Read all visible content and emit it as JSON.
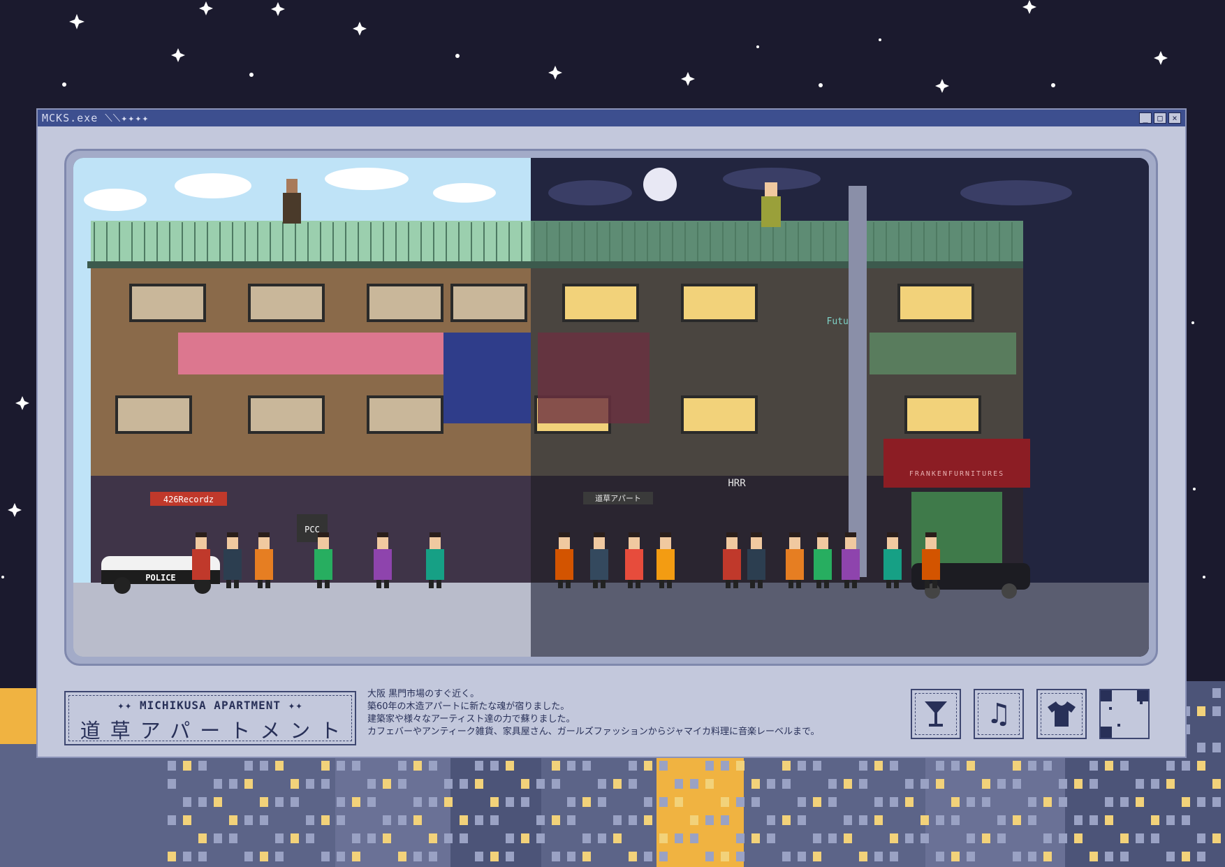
{
  "window": {
    "title": "MCKS.exe ⟍⟍✦✦✦✦",
    "min_label": "_",
    "max_label": "□",
    "close_label": "×"
  },
  "scene": {
    "signs": {
      "records": "426Recordz",
      "police": "POLICE",
      "pcc": "PCC",
      "apartment_sign": "道草アパート",
      "hrr": "HRR",
      "future": "Future",
      "furniture": "FRANKENFURNITURES"
    }
  },
  "label": {
    "english": "✦✦ MICHIKUSA APARTMENT ✦✦",
    "japanese": "道草アパートメント"
  },
  "description": {
    "lines": [
      "大阪 黒門市場のすぐ近く。",
      "築60年の木造アパートに新たな魂が宿りました。",
      "建築家や様々なアーティスト達の力で蘇りました。",
      "カフェバーやアンティーク雑貨、家具屋さん、ガールズファッションからジャマイカ料理に音楽レーベルまで。"
    ]
  },
  "buttons": {
    "cocktail": "cocktail-icon",
    "music": "music-note-icon",
    "shirt": "tshirt-icon",
    "qr": "qr-code-icon"
  },
  "colors": {
    "background": "#1b1a2e",
    "window": "#c3c8dc",
    "titlebar": "#3d4f8f",
    "text": "#283058",
    "day_sky": "#bfe3f7",
    "night_sky": "#22253f",
    "roof": "#7fb594",
    "window_light": "#f2d27a"
  }
}
